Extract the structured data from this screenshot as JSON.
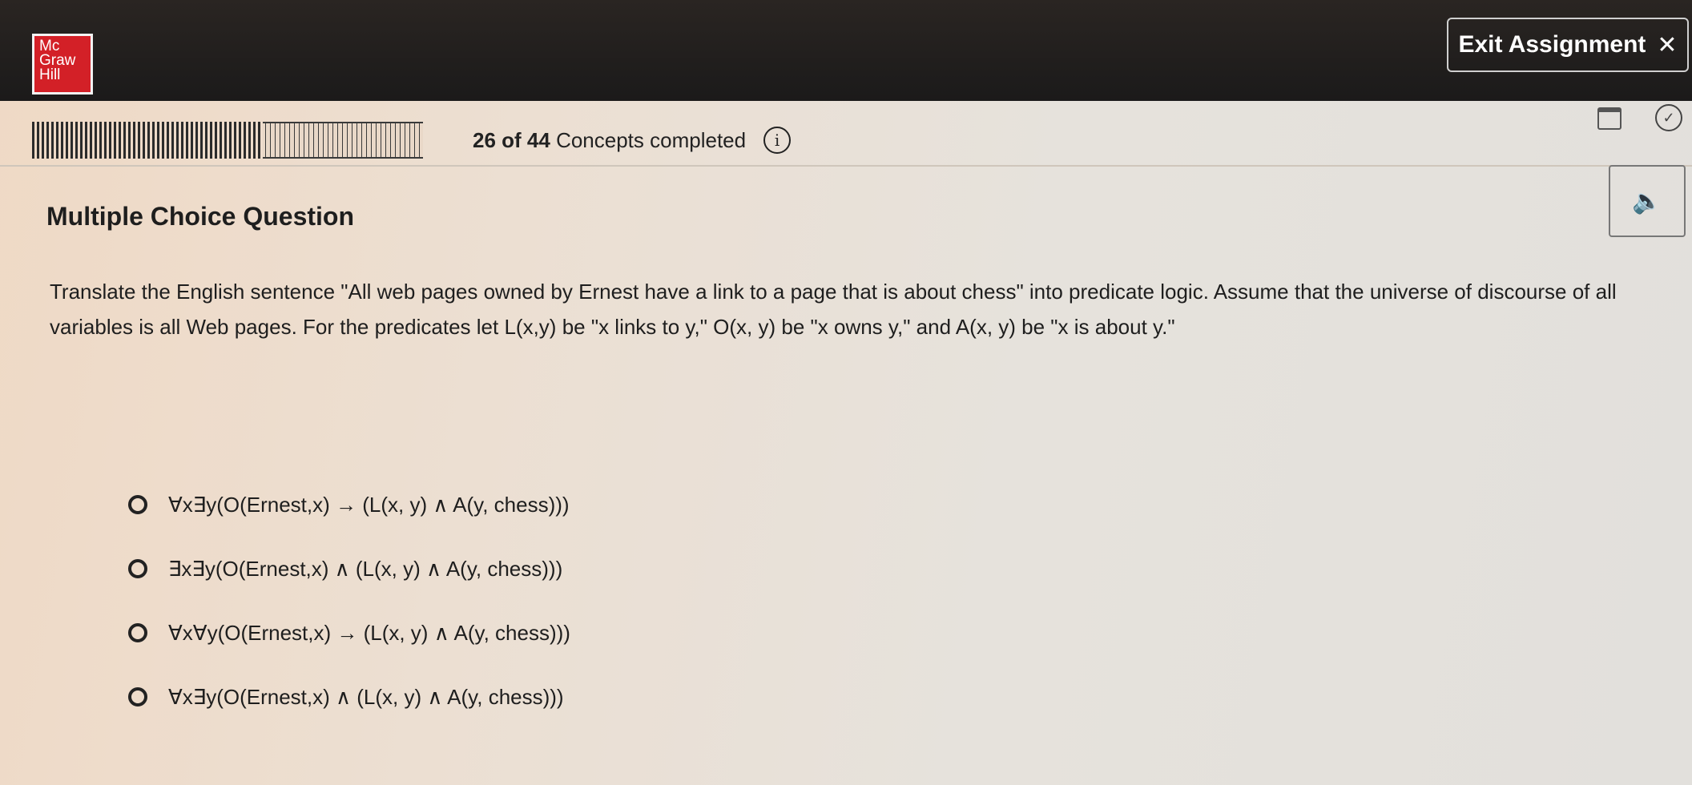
{
  "header": {
    "logo_lines": [
      "Mc",
      "Graw",
      "Hill"
    ],
    "exit_label": "Exit Assignment",
    "exit_icon": "close-icon"
  },
  "progress": {
    "completed": 26,
    "total": 44,
    "count_text": "26 of 44",
    "label_text": "Concepts completed",
    "info_icon": "i"
  },
  "question": {
    "type_heading": "Multiple Choice Question",
    "prompt": "Translate the English sentence \"All web pages owned by Ernest have a link to a page that is about chess\" into predicate logic. Assume that the universe of discourse of all variables is all Web pages. For the predicates let L(x,y) be \"x links to y,\" O(x, y) be \"x owns y,\" and A(x, y) be \"x is about y.\"",
    "options": [
      "∀x∃y(O(Ernest,x) → (L(x, y) ∧ A(y, chess)))",
      "∃x∃y(O(Ernest,x) ∧ (L(x, y) ∧ A(y, chess)))",
      "∀x∀y(O(Ernest,x) → (L(x, y) ∧ A(y, chess)))",
      "∀x∃y(O(Ernest,x) ∧ (L(x, y) ∧ A(y, chess)))"
    ]
  },
  "icons": {
    "calendar": "calendar-icon",
    "checkmark": "checkmark-circle-icon",
    "speaker": "speaker-icon"
  }
}
